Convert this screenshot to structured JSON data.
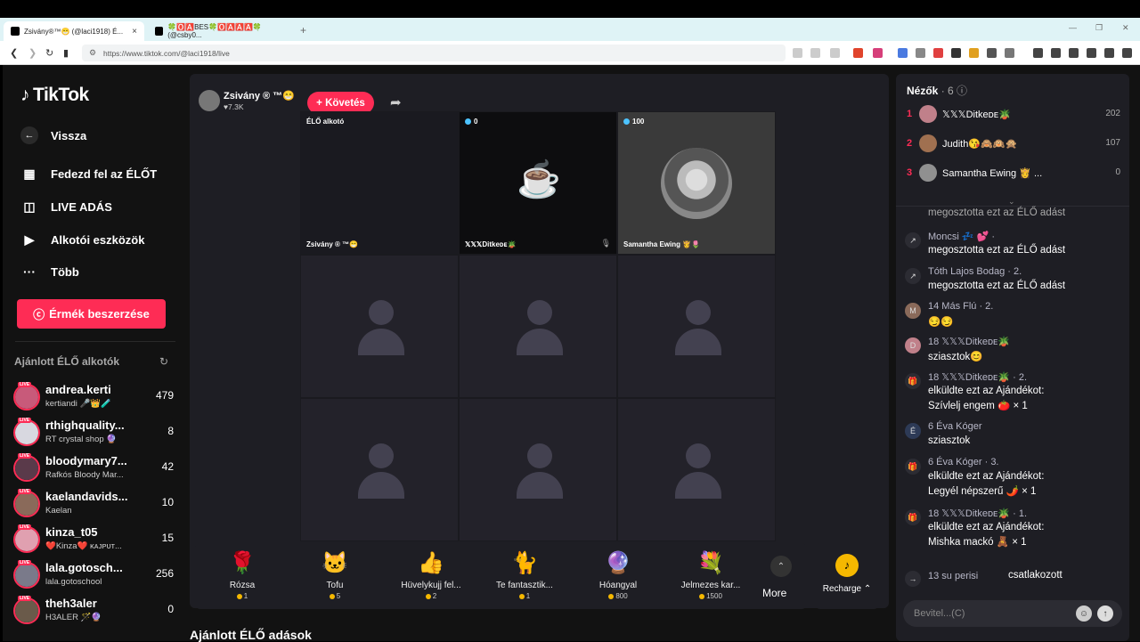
{
  "browser": {
    "tabs": [
      {
        "label": "Zsivány®™😁 (@laci1918) É..."
      },
      {
        "label": "🍀🅾️🅰️BES🍀🅾️🅰️🅰️🅰️🍀 (@csby0..."
      }
    ],
    "url": "https://www.tiktok.com/@laci1918/live"
  },
  "sidebar": {
    "logo": "TikTok",
    "back": "Vissza",
    "nav": [
      {
        "label": "Fedezd fel az ÉLŐT"
      },
      {
        "label": "LIVE ADÁS"
      },
      {
        "label": "Alkotói eszközök"
      },
      {
        "label": "Több"
      }
    ],
    "coins_button": "Érmék beszerzése",
    "recommended_title": "Ajánlott ÉLŐ alkotók",
    "creators": [
      {
        "name": "andrea.kerti",
        "sub": "kertiandi 🎤👑🧪",
        "count": "479",
        "color": "#c85a7a"
      },
      {
        "name": "rthighquality...",
        "sub": "RT crystal shop 🔮",
        "count": "8",
        "color": "#d8d8e0"
      },
      {
        "name": "bloodymary7...",
        "sub": "Rafkós Bloody Mar...",
        "count": "42",
        "color": "#5a3a4a"
      },
      {
        "name": "kaelandavids...",
        "sub": "Kaelan",
        "count": "10",
        "color": "#8a6a5a"
      },
      {
        "name": "kinza_t05",
        "sub": "❤️Kinza❤️ ᴋᴀᴊᴘᴜᴛ...",
        "count": "15",
        "color": "#e0a0b0"
      },
      {
        "name": "lala.gotosch...",
        "sub": "lala.gotoschool",
        "count": "256",
        "color": "#7a7a8a"
      },
      {
        "name": "theh3aler",
        "sub": "H3ALER 🪄🔮",
        "count": "0",
        "color": "#6a5a4a"
      }
    ]
  },
  "stream": {
    "host_name": "Zsivány ® ™😁",
    "host_likes": "♥7.3K",
    "follow_button": "+ Követés",
    "cells": [
      {
        "hdr": "ÉLŐ alkotó",
        "label": "Zsivány ® ™😁"
      },
      {
        "hdr": "0",
        "label": "𝕏𝕏𝕏Ditkeᴅᴇ🪴"
      },
      {
        "hdr": "100",
        "label": "Samantha Ewing 👸🌷"
      }
    ],
    "gifts": [
      {
        "icon": "🌹",
        "name": "Rózsa",
        "price": "1"
      },
      {
        "icon": "🐱",
        "name": "Tofu",
        "price": "5"
      },
      {
        "icon": "👍",
        "name": "Hüvelykujj fel...",
        "price": "2"
      },
      {
        "icon": "🐈",
        "name": "Te fantasztik...",
        "price": "1"
      },
      {
        "icon": "🔮",
        "name": "Hóangyal",
        "price": "800"
      },
      {
        "icon": "💐",
        "name": "Jelmezes kar...",
        "price": "1500"
      }
    ],
    "more_label": "More",
    "recharge_label": "Recharge ⌃",
    "bottom_heading": "Ajánlott ÉLŐ adások"
  },
  "chat": {
    "viewers_title": "Nézők",
    "viewers_count": "· 6",
    "viewers": [
      {
        "rank": "1",
        "name": "𝕏𝕏𝕏Ditkeᴅᴇ🪴",
        "score": "202",
        "color": "#c0808a"
      },
      {
        "rank": "2",
        "name": "Judith😘🙈🙉🙊",
        "score": "107",
        "color": "#a07050"
      },
      {
        "rank": "3",
        "name": "Samantha Ewing 👸 ...",
        "score": "0",
        "color": "#909090"
      }
    ],
    "messages": [
      {
        "icon": "↗",
        "name": "",
        "text": "megosztotta ezt az ÉLŐ adást"
      },
      {
        "icon": "↗",
        "name": "Moncsi 💤 💕 ·",
        "text": "megosztotta ezt az ÉLŐ adást"
      },
      {
        "icon": "↗",
        "name": "Tóth Lajos Bodag · 2.",
        "text": "megosztotta ezt az ÉLŐ adást"
      },
      {
        "icon": "M",
        "name": "14 Más Flú · 2.",
        "text": "😏😏"
      },
      {
        "icon": "D",
        "name": "18 𝕏𝕏𝕏Ditkeᴅᴇ🪴",
        "text": "sziasztok😊"
      },
      {
        "icon": "🎁",
        "name": "18 𝕏𝕏𝕏Ditkeᴅᴇ🪴 · 2.",
        "text": "elküldte ezt az Ajándékot:"
      },
      {
        "icon": "",
        "name": "",
        "text": "Szívlelj engem 🍅 × 1"
      },
      {
        "icon": "É",
        "name": "6 Éva Kóger",
        "text": "sziasztok"
      },
      {
        "icon": "🎁",
        "name": "6 Éva Kóger · 3.",
        "text": "elküldte ezt az Ajándékot:"
      },
      {
        "icon": "",
        "name": "",
        "text": "Legyél népszerű 🌶️ × 1"
      },
      {
        "icon": "🎁",
        "name": "18 𝕏𝕏𝕏Ditkeᴅᴇ🪴 · 1.",
        "text": "elküldte ezt az Ajándékot:"
      },
      {
        "icon": "",
        "name": "",
        "text": "Mishka mackó 🧸 × 1"
      },
      {
        "icon": "→",
        "name": "13 su perisi",
        "text": "csatlakozott"
      }
    ],
    "input_placeholder": "Bevitel...(C)"
  }
}
